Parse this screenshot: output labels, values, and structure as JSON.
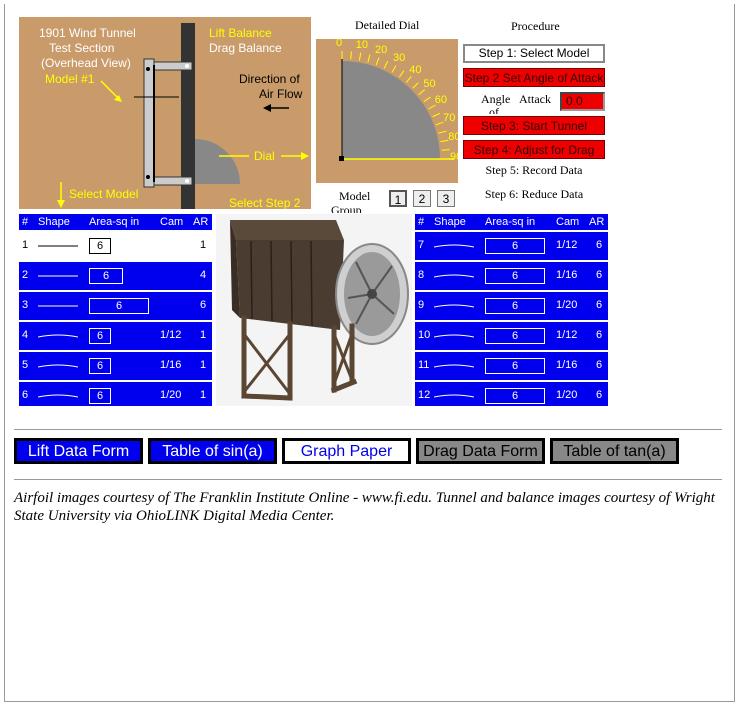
{
  "wind_tunnel": {
    "title": "1901 Wind Tunnel",
    "subtitle_1": "Test Section",
    "subtitle_2": "(Overhead View)",
    "model_label": "Model #1",
    "lift_balance": "Lift Balance",
    "drag_balance": "Drag Balance",
    "direction_1": "Direction of",
    "direction_2": "Air Flow",
    "dial_label": "Dial",
    "select_model": "Select Model",
    "select_step": "Select Step 2"
  },
  "detailed_dial": {
    "title": "Detailed Dial",
    "ticks": [
      "0",
      "10",
      "20",
      "30",
      "40",
      "50",
      "60",
      "70",
      "80",
      "90"
    ]
  },
  "procedure": {
    "title": "Procedure",
    "step1": "Step 1: Select Model",
    "step2": "Step 2 Set Angle of Attack",
    "angle_label_1": "Angle",
    "angle_label_2": "of",
    "angle_label_3": "Attack",
    "angle_value": "0.0",
    "step3": "Step 3: Start Tunnel",
    "step4": "Step 4: Adjust for Drag",
    "step5": "Step 5: Record Data",
    "step6": "Step 6: Reduce Data"
  },
  "model_group": {
    "label_1": "Model",
    "label_2": "Group",
    "options": [
      "1",
      "2",
      "3"
    ]
  },
  "table_headers": {
    "num": "#",
    "shape": "Shape",
    "area": "Area-sq in",
    "cam": "Cam",
    "ar": "AR"
  },
  "left_rows": [
    {
      "num": "1",
      "area": "6",
      "cam": "",
      "ar": "1"
    },
    {
      "num": "2",
      "area": "6",
      "cam": "",
      "ar": "4"
    },
    {
      "num": "3",
      "area": "6",
      "cam": "",
      "ar": "6"
    },
    {
      "num": "4",
      "area": "6",
      "cam": "1/12",
      "ar": "1"
    },
    {
      "num": "5",
      "area": "6",
      "cam": "1/16",
      "ar": "1"
    },
    {
      "num": "6",
      "area": "6",
      "cam": "1/20",
      "ar": "1"
    }
  ],
  "right_rows": [
    {
      "num": "7",
      "area": "6",
      "cam": "1/12",
      "ar": "6"
    },
    {
      "num": "8",
      "area": "6",
      "cam": "1/16",
      "ar": "6"
    },
    {
      "num": "9",
      "area": "6",
      "cam": "1/20",
      "ar": "6"
    },
    {
      "num": "10",
      "area": "6",
      "cam": "1/12",
      "ar": "6"
    },
    {
      "num": "11",
      "area": "6",
      "cam": "1/16",
      "ar": "6"
    },
    {
      "num": "12",
      "area": "6",
      "cam": "1/20",
      "ar": "6"
    }
  ],
  "buttons": {
    "lift_form": "Lift Data Form",
    "sin_table": "Table of sin(a)",
    "graph_paper": "Graph Paper",
    "drag_form": "Drag Data Form",
    "tan_table": "Table of tan(a)"
  },
  "credits": "Airfoil images courtesy of The Franklin Institute Online - www.fi.edu. Tunnel and balance images courtesy of Wright State University via OhioLINK Digital Media Center."
}
